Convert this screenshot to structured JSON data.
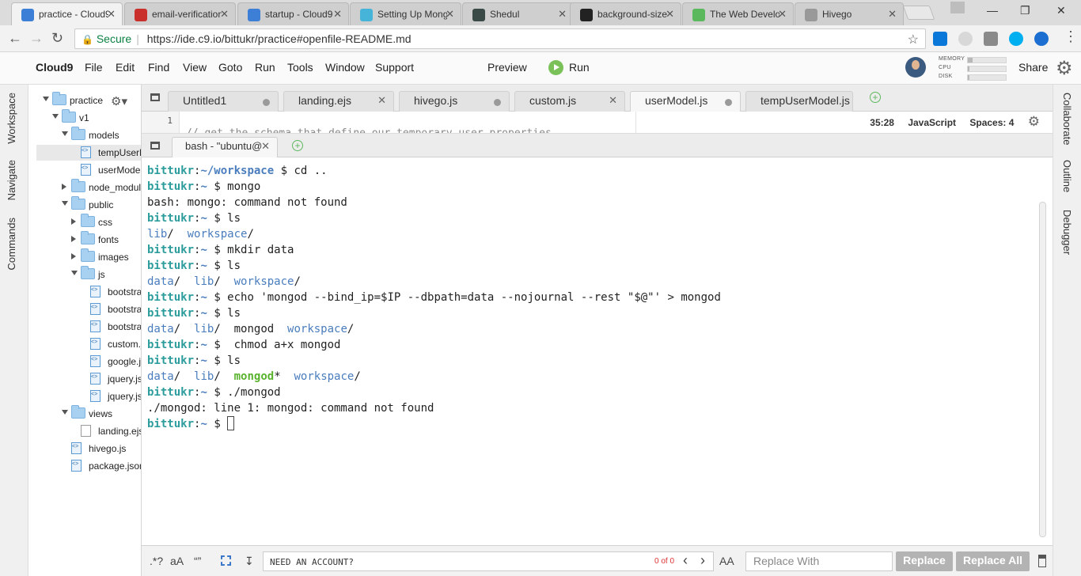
{
  "browser": {
    "tabs": [
      {
        "title": "practice - Cloud9",
        "color": "#3d7fd6",
        "active": true
      },
      {
        "title": "email-verification",
        "color": "#c9302c"
      },
      {
        "title": "startup - Cloud9",
        "color": "#3d7fd6"
      },
      {
        "title": "Setting Up MongoDB",
        "color": "#46b3d9"
      },
      {
        "title": "Shedul",
        "color": "#3a4b47"
      },
      {
        "title": "background-size",
        "color": "#222222"
      },
      {
        "title": "The Web Developer",
        "color": "#5cb85c"
      },
      {
        "title": "Hivego",
        "color": "#999999"
      }
    ],
    "url": {
      "secure_label": "Secure",
      "url": "https://ide.c9.io/bittukr/practice#openfile-README.md"
    }
  },
  "menu": {
    "brand": "Cloud9",
    "items": [
      "File",
      "Edit",
      "Find",
      "View",
      "Goto",
      "Run",
      "Tools",
      "Window",
      "Support"
    ],
    "preview": "Preview",
    "run": "Run",
    "share": "Share",
    "meters": [
      {
        "label": "MEMORY",
        "fill": 0.12
      },
      {
        "label": "CPU",
        "fill": 0.05
      },
      {
        "label": "DISK",
        "fill": 0.05
      }
    ]
  },
  "left_panels": [
    "Workspace",
    "Navigate",
    "Commands"
  ],
  "right_panels": [
    "Collaborate",
    "Outline",
    "Debugger"
  ],
  "tree": {
    "nodes": [
      {
        "label": "practice",
        "type": "folder",
        "arrow": "down"
      },
      {
        "label": "v1",
        "type": "folder",
        "arrow": "down"
      },
      {
        "label": "models",
        "type": "folder",
        "arrow": "down"
      },
      {
        "label": "tempUserModel.js",
        "type": "js",
        "selected": true
      },
      {
        "label": "userModel.js",
        "type": "js"
      },
      {
        "label": "node_modules",
        "type": "folder",
        "arrow": "right"
      },
      {
        "label": "public",
        "type": "folder",
        "arrow": "down"
      },
      {
        "label": "css",
        "type": "folder",
        "arrow": "right"
      },
      {
        "label": "fonts",
        "type": "folder",
        "arrow": "right"
      },
      {
        "label": "images",
        "type": "folder",
        "arrow": "right"
      },
      {
        "label": "js",
        "type": "folder",
        "arrow": "down"
      },
      {
        "label": "bootstrap.js",
        "type": "js"
      },
      {
        "label": "bootstrap.js",
        "type": "js"
      },
      {
        "label": "bootstrap.js",
        "type": "js"
      },
      {
        "label": "custom.js",
        "type": "js"
      },
      {
        "label": "google.js",
        "type": "js"
      },
      {
        "label": "jquery.js",
        "type": "js"
      },
      {
        "label": "jquery.js",
        "type": "js"
      },
      {
        "label": "views",
        "type": "folder",
        "arrow": "down"
      },
      {
        "label": "landing.ejs",
        "type": "file"
      },
      {
        "label": "hivego.js",
        "type": "js"
      },
      {
        "label": "package.json",
        "type": "js"
      }
    ]
  },
  "editor": {
    "tabs": [
      {
        "label": "Untitled1",
        "mark": "dot"
      },
      {
        "label": "landing.ejs",
        "mark": "x"
      },
      {
        "label": "hivego.js",
        "mark": "dot"
      },
      {
        "label": "custom.js",
        "mark": "x"
      },
      {
        "label": "userModel.js",
        "mark": "dot",
        "active": true
      },
      {
        "label": "tempUserModel.js",
        "mark": "none"
      }
    ],
    "line_number": "1",
    "code_line": "// get the schema that define our temporary user properties",
    "status": {
      "position": "35:28",
      "language": "JavaScript",
      "spaces": "Spaces: 4"
    }
  },
  "terminal": {
    "tab_label": "bash - \"ubuntu@",
    "lines": [
      [
        {
          "t": "bittukr",
          "c": "u"
        },
        {
          "t": ":"
        },
        {
          "t": "~/workspace",
          "c": "pth"
        },
        {
          "t": " $ cd .."
        }
      ],
      [
        {
          "t": "bittukr",
          "c": "u"
        },
        {
          "t": ":"
        },
        {
          "t": "~",
          "c": "pth"
        },
        {
          "t": " $ mongo"
        }
      ],
      [
        {
          "t": "bash: mongo: command not found"
        }
      ],
      [
        {
          "t": "bittukr",
          "c": "u"
        },
        {
          "t": ":"
        },
        {
          "t": "~",
          "c": "pth"
        },
        {
          "t": " $ ls"
        }
      ],
      [
        {
          "t": "lib",
          "c": "d"
        },
        {
          "t": "/  "
        },
        {
          "t": "workspace",
          "c": "d"
        },
        {
          "t": "/"
        }
      ],
      [
        {
          "t": "bittukr",
          "c": "u"
        },
        {
          "t": ":"
        },
        {
          "t": "~",
          "c": "pth"
        },
        {
          "t": " $ mkdir data"
        }
      ],
      [
        {
          "t": "bittukr",
          "c": "u"
        },
        {
          "t": ":"
        },
        {
          "t": "~",
          "c": "pth"
        },
        {
          "t": " $ ls"
        }
      ],
      [
        {
          "t": "data",
          "c": "d"
        },
        {
          "t": "/  "
        },
        {
          "t": "lib",
          "c": "d"
        },
        {
          "t": "/  "
        },
        {
          "t": "workspace",
          "c": "d"
        },
        {
          "t": "/"
        }
      ],
      [
        {
          "t": "bittukr",
          "c": "u"
        },
        {
          "t": ":"
        },
        {
          "t": "~",
          "c": "pth"
        },
        {
          "t": " $ echo 'mongod --bind_ip=$IP --dbpath=data --nojournal --rest \"$@\"' > mongod"
        }
      ],
      [
        {
          "t": "bittukr",
          "c": "u"
        },
        {
          "t": ":"
        },
        {
          "t": "~",
          "c": "pth"
        },
        {
          "t": " $ ls"
        }
      ],
      [
        {
          "t": "data",
          "c": "d"
        },
        {
          "t": "/  "
        },
        {
          "t": "lib",
          "c": "d"
        },
        {
          "t": "/  mongod  "
        },
        {
          "t": "workspace",
          "c": "d"
        },
        {
          "t": "/"
        }
      ],
      [
        {
          "t": "bittukr",
          "c": "u"
        },
        {
          "t": ":"
        },
        {
          "t": "~",
          "c": "pth"
        },
        {
          "t": " $  chmod a+x mongod"
        }
      ],
      [
        {
          "t": "bittukr",
          "c": "u"
        },
        {
          "t": ":"
        },
        {
          "t": "~",
          "c": "pth"
        },
        {
          "t": " $ ls"
        }
      ],
      [
        {
          "t": "data",
          "c": "d"
        },
        {
          "t": "/  "
        },
        {
          "t": "lib",
          "c": "d"
        },
        {
          "t": "/  "
        },
        {
          "t": "mongod",
          "c": "g"
        },
        {
          "t": "*  "
        },
        {
          "t": "workspace",
          "c": "d"
        },
        {
          "t": "/"
        }
      ],
      [
        {
          "t": "bittukr",
          "c": "u"
        },
        {
          "t": ":"
        },
        {
          "t": "~",
          "c": "pth"
        },
        {
          "t": " $ ./mongod"
        }
      ],
      [
        {
          "t": "./mongod: line 1: mongod: command not found"
        }
      ],
      [
        {
          "t": "bittukr",
          "c": "u"
        },
        {
          "t": ":"
        },
        {
          "t": "~",
          "c": "pth"
        },
        {
          "t": " $ "
        },
        {
          "t": "",
          "c": "cursor"
        }
      ]
    ]
  },
  "find": {
    "regex": ".*?",
    "case": "aA",
    "words": "“”",
    "input_value": "NEED AN ACCOUNT?",
    "count": "0 of 0",
    "replace_placeholder": "Replace With",
    "replace_label": "Replace",
    "replace_all_label": "Replace All",
    "preserve_case": "AA"
  },
  "colors": {
    "run_green": "#7bc15a",
    "prompt_user": "#2d9c9c",
    "dir_blue": "#4a7dbd",
    "exec_green": "#59b32d"
  }
}
